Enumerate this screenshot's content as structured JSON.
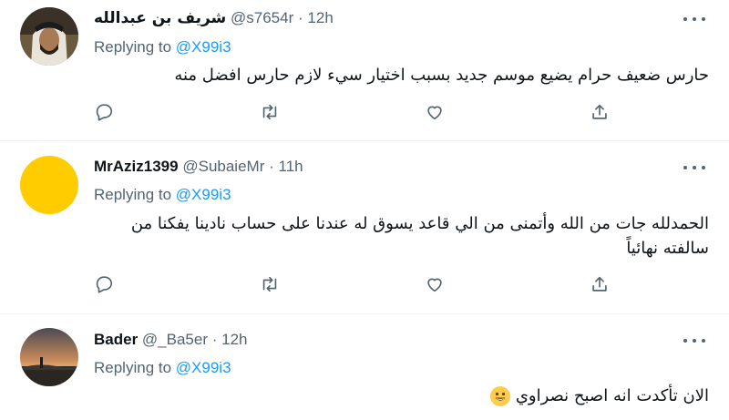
{
  "tweets": [
    {
      "name": "شريف بن عبدالله",
      "handle": "@s7654r",
      "dot": "·",
      "time": "12h",
      "replying_prefix": "Replying to",
      "replying_to": "@X99i3",
      "text": "حارس ضعيف حرام يضيع موسم جديد بسبب اختيار سيء لازم حارس افضل منه",
      "avatar": "avatar-photo-man-with-headscarf"
    },
    {
      "name": "MrAziz1399",
      "handle": "@SubaieMr",
      "dot": "·",
      "time": "11h",
      "replying_prefix": "Replying to",
      "replying_to": "@X99i3",
      "text": "الحمدلله جات من الله وأتمنى من الي قاعد يسوق له عندنا على حساب نادينا يفكنا من سالفته نهائياً",
      "avatar_color": "#ffcc00"
    },
    {
      "name": "Bader",
      "handle": "@_Ba5er",
      "dot": "·",
      "time": "12h",
      "replying_prefix": "Replying to",
      "replying_to": "@X99i3",
      "text": "الان تأكدت انه اصبح نصراوي",
      "emoji": "grinning-face-emoji",
      "avatar": "avatar-photo-sunset-landscape"
    }
  ],
  "icons": {
    "reply": "reply-icon",
    "retweet": "retweet-icon",
    "like": "like-icon",
    "share": "share-icon",
    "more": "more-icon"
  },
  "colors": {
    "link": "#1d9bf0",
    "secondary_text": "#536471",
    "divider": "#eff3f4"
  }
}
